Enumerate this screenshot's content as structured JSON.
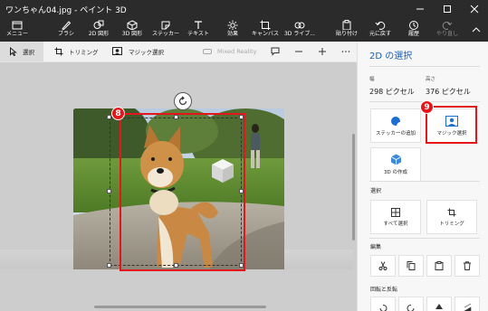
{
  "window": {
    "title": "ワンちゃん04.jpg - ペイント 3D"
  },
  "ribbon": {
    "items": [
      {
        "label": "メニュー",
        "icon": "folder-menu-icon"
      },
      {
        "label": "ブラシ",
        "icon": "brush-icon"
      },
      {
        "label": "2D 図形",
        "icon": "2d-shapes-icon"
      },
      {
        "label": "3D 図形",
        "icon": "3d-shapes-icon"
      },
      {
        "label": "ステッカー",
        "icon": "stickers-icon"
      },
      {
        "label": "テキスト",
        "icon": "text-icon"
      },
      {
        "label": "効果",
        "icon": "effects-icon"
      },
      {
        "label": "キャンバス",
        "icon": "canvas-icon"
      },
      {
        "label": "3D ライブ...",
        "icon": "3d-library-icon"
      },
      {
        "label": "貼り付け",
        "icon": "paste-icon"
      },
      {
        "label": "元に戻す",
        "icon": "undo-icon"
      },
      {
        "label": "履歴",
        "icon": "history-icon"
      },
      {
        "label": "やり直し",
        "icon": "redo-icon"
      }
    ]
  },
  "toolbar": {
    "select_label": "選択",
    "crop_label": "トリミング",
    "magic_select_label": "マジック選択",
    "mixed_reality_label": "Mixed Reality"
  },
  "panel": {
    "title": "2D の選択",
    "width_label": "幅",
    "width_value": "298 ピクセル",
    "height_label": "高さ",
    "height_value": "376 ピクセル",
    "make_sticker_label": "ステッカーの追加",
    "magic_select_label": "マジック選択",
    "make_3d_label": "3D の作成",
    "select_section": "選択",
    "select_all_label": "すべて選択",
    "crop_label": "トリミング",
    "edit_section": "編集",
    "rotate_flip_section": "回転と反転"
  },
  "annotations": {
    "badge_8": "8",
    "badge_9": "9"
  },
  "colors": {
    "titlebar": "#2b2b2b",
    "accent_blue": "#1a5fb4",
    "highlight_red": "#e4161b",
    "canvas_bg": "#cdcdcd"
  }
}
